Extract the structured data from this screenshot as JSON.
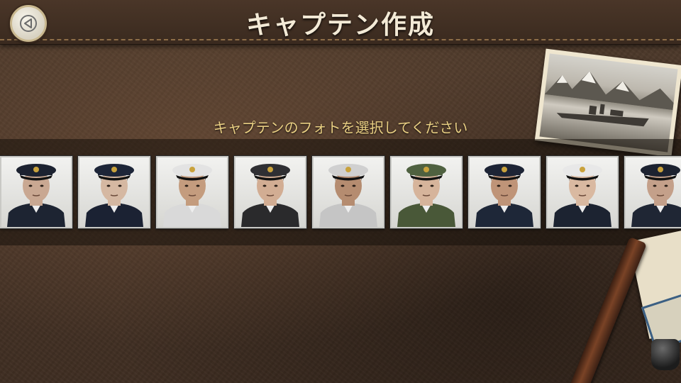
{
  "header": {
    "title": "キャプテン作成"
  },
  "prompt": "キャプテンのフォトを選択してください",
  "captains": [
    {
      "uniform": "#1d2432",
      "cap": "#1c2230",
      "hair": "#d9d9d9",
      "skin": "#c9a892"
    },
    {
      "uniform": "#1b2233",
      "cap": "#1d2538",
      "hair": "#2a211b",
      "skin": "#d5b8a2"
    },
    {
      "uniform": "#d9d9d9",
      "cap": "#e3e3e3",
      "hair": "#2a211b",
      "skin": "#c49c7e"
    },
    {
      "uniform": "#2a2a2c",
      "cap": "#2f2f33",
      "hair": "#3b2a20",
      "skin": "#d2ad93"
    },
    {
      "uniform": "#c5c5c5",
      "cap": "#d0d0d0",
      "hair": "#4a3c31",
      "skin": "#b58c70"
    },
    {
      "uniform": "#495838",
      "cap": "#4f6140",
      "hair": "#2e2018",
      "skin": "#d6b49b"
    },
    {
      "uniform": "#1e2738",
      "cap": "#1d2435",
      "hair": "#1b1613",
      "skin": "#bf9478"
    },
    {
      "uniform": "#1c2331",
      "cap": "#e8e8e8",
      "hair": "#2e2018",
      "skin": "#d9b9a1"
    },
    {
      "uniform": "#1f2634",
      "cap": "#1c2230",
      "hair": "#cfcfcf",
      "skin": "#c4a08a"
    }
  ]
}
